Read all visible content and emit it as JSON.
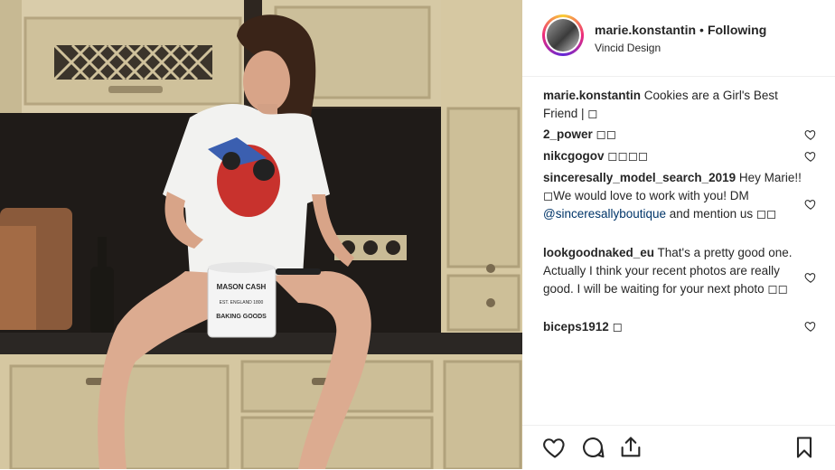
{
  "header": {
    "username": "marie.konstantin",
    "separator": "•",
    "follow_status": "Following",
    "subtitle": "Vincid Design"
  },
  "caption": {
    "username": "marie.konstantin",
    "text": "Cookies are a Girl's Best Friend | ◻"
  },
  "comments": [
    {
      "username": "2_power",
      "text": "◻◻"
    },
    {
      "username": "nikcgogov",
      "text": "◻◻◻◻"
    },
    {
      "username": "sinceresally_model_search_2019",
      "text_before": "Hey Marie!! ◻We would love to work with you! DM ",
      "mention": "@sinceresallyboutique",
      "text_after": " and mention us ◻◻"
    },
    {
      "username": "lookgoodnaked_eu",
      "text": "That's a pretty good one. Actually I think your recent photos are really good. I will be waiting for your next photo ◻◻"
    },
    {
      "username": "biceps1912",
      "text": "◻"
    }
  ],
  "photo": {
    "tin_line1": "MASON CASH",
    "tin_line2": "EST. ENGLAND 1800",
    "tin_line3": "BAKING GOODS"
  },
  "icons": {
    "heart": "heart-outline-icon",
    "comment": "comment-bubble-icon",
    "share": "share-upload-icon",
    "save": "bookmark-icon"
  },
  "colors": {
    "text": "#262626",
    "mention": "#003569",
    "border": "#efefef"
  }
}
